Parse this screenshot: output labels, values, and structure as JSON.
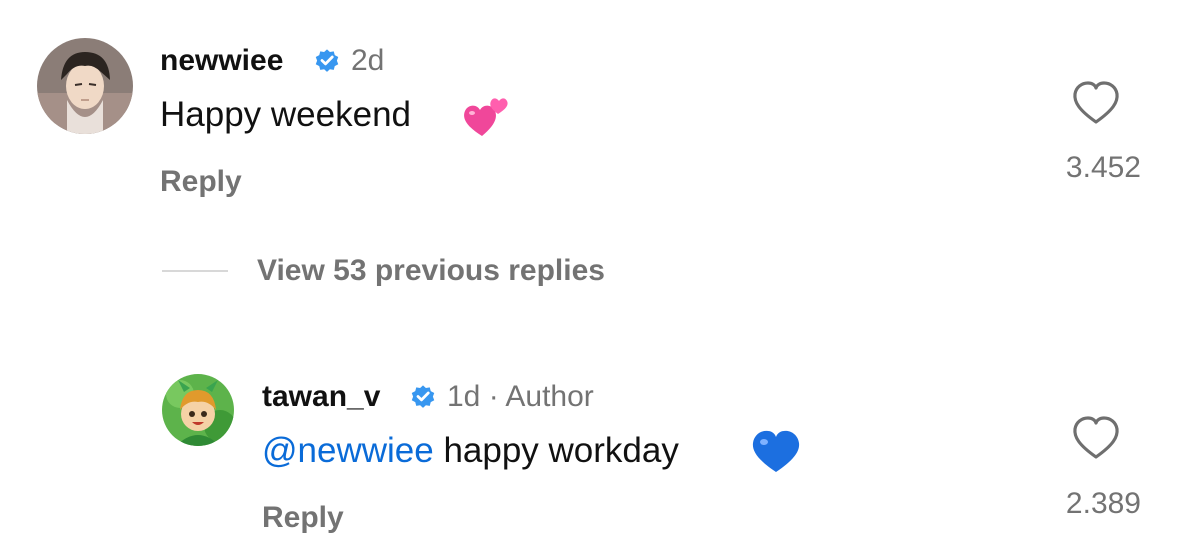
{
  "comments": [
    {
      "username": "newwiee",
      "time": "2d",
      "text": "Happy weekend",
      "emoji_icon": "two-hearts-emoji",
      "reply_label": "Reply",
      "like_count": "3.452",
      "avatar_icon": "anime-character-avatar"
    }
  ],
  "thread": {
    "view_previous_label": "View 53 previous replies"
  },
  "replies": [
    {
      "username": "tawan_v",
      "time": "1d",
      "separator": "·",
      "role_label": "Author",
      "mention": "@newwiee",
      "text": " happy workday",
      "emoji_icon": "blue-heart-emoji",
      "reply_label": "Reply",
      "like_count": "2.389",
      "avatar_icon": "cartoon-character-avatar"
    }
  ],
  "colors": {
    "verified": "#3897f0",
    "mention": "#0a6bd8",
    "secondary_text": "#737373"
  }
}
